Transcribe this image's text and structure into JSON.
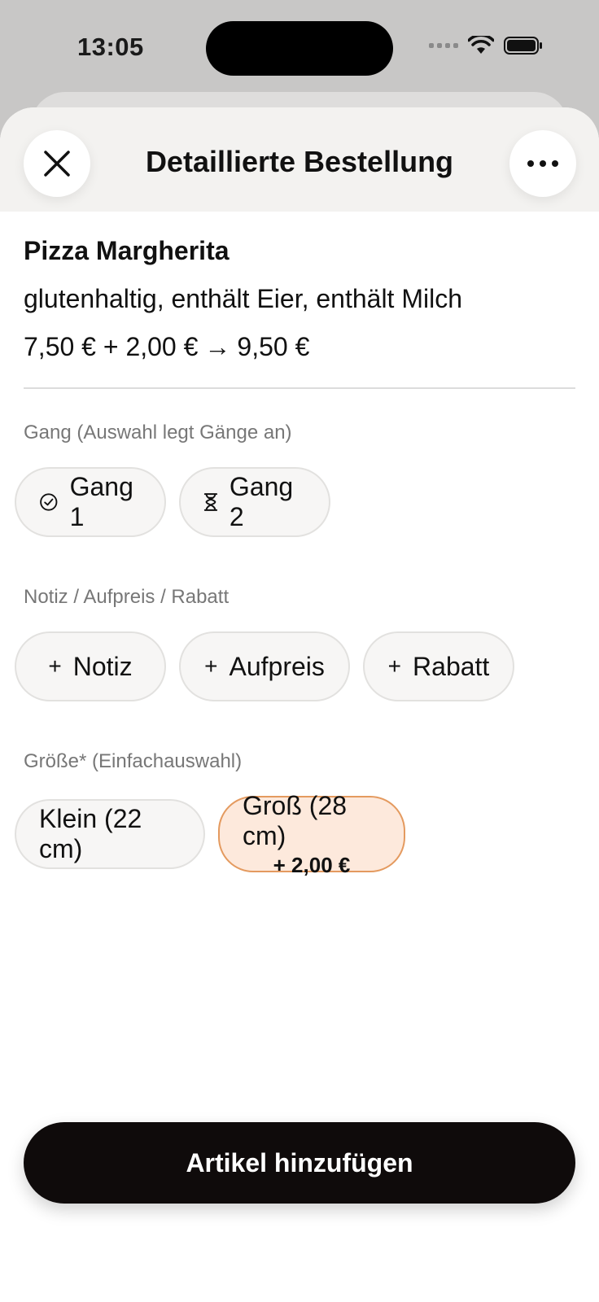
{
  "status_bar": {
    "time": "13:05"
  },
  "header": {
    "title": "Detaillierte Bestellung"
  },
  "item": {
    "name": "Pizza Margherita",
    "allergens": "glutenhaltig, enthält Eier, enthält Milch",
    "price_base": "7,50 € + 2,00 €",
    "price_arrow": "→",
    "price_total": "9,50 €"
  },
  "course_section": {
    "label": "Gang (Auswahl legt Gänge an)",
    "options": [
      {
        "label": "Gang 1",
        "icon": "check-circle-icon"
      },
      {
        "label": "Gang 2",
        "icon": "hourglass-icon"
      }
    ]
  },
  "extras_section": {
    "label": "Notiz / Aufpreis / Rabatt",
    "options": [
      {
        "label": "Notiz",
        "icon": "plus-icon"
      },
      {
        "label": "Aufpreis",
        "icon": "plus-icon"
      },
      {
        "label": "Rabatt",
        "icon": "plus-icon"
      }
    ]
  },
  "size_section": {
    "label": "Größe* (Einfachauswahl)",
    "options": [
      {
        "label": "Klein (22 cm)",
        "selected": false
      },
      {
        "label": "Groß (28 cm)",
        "surcharge": "+ 2,00 €",
        "selected": true
      }
    ]
  },
  "footer": {
    "add_label": "Artikel hinzufügen"
  },
  "colors": {
    "selected_fill": "#fde9dc",
    "selected_border": "#e49a5f",
    "primary_button": "#0f0b0b"
  }
}
